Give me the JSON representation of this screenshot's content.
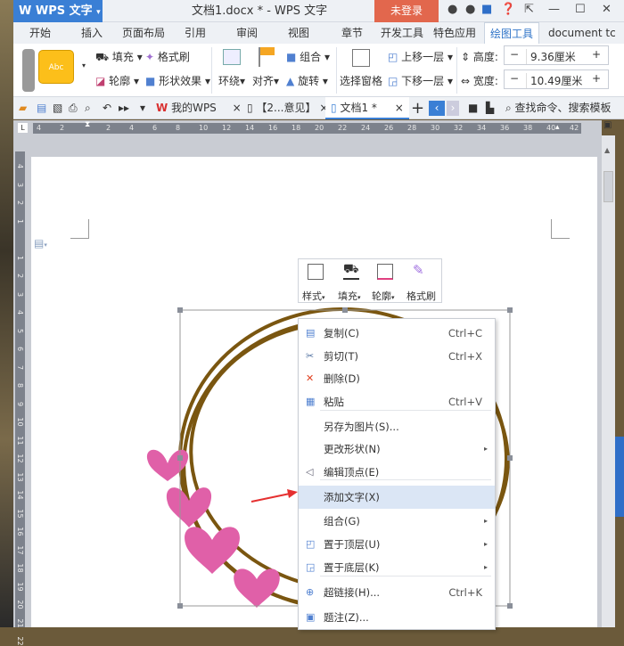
{
  "titlebar": {
    "app_button": "W WPS 文字",
    "doc_title": "文档1.docx * - WPS 文字",
    "login": "未登录"
  },
  "tabs": [
    "开始",
    "插入",
    "页面布局",
    "引用",
    "审阅",
    "视图",
    "章节",
    "开发工具",
    "特色应用",
    "绘图工具",
    "document tc"
  ],
  "active_tab": "绘图工具",
  "ribbon": {
    "style_preview": "Abc",
    "fill": "填充",
    "format_painter": "格式刷",
    "outline": "轮廓",
    "shape_effects": "形状效果",
    "wrap": "环绕",
    "align": "对齐",
    "group": "组合",
    "rotate": "旋转",
    "selection_pane": "选择窗格",
    "bring_forward": "上移一层",
    "send_backward": "下移一层",
    "height_label": "高度:",
    "height_value": "9.36厘米",
    "width_label": "宽度:",
    "width_value": "10.49厘米"
  },
  "doc_tabs": [
    {
      "label": "我的WPS"
    },
    {
      "label": "【2...意见】"
    },
    {
      "label": "文档1 *"
    }
  ],
  "search_placeholder": "查找命令、搜索模板",
  "ruler": {
    "h_ticks": [
      "4",
      "2",
      "",
      "2",
      "4",
      "6",
      "8",
      "10",
      "12",
      "14",
      "16",
      "18",
      "20",
      "22",
      "24",
      "26",
      "28",
      "30",
      "32",
      "34",
      "36",
      "38",
      "40",
      "42"
    ],
    "v_ticks": [
      "4",
      "3",
      "2",
      "1",
      "",
      "1",
      "2",
      "3",
      "4",
      "5",
      "6",
      "7",
      "8",
      "9",
      "10",
      "11",
      "12",
      "13",
      "14",
      "15",
      "16",
      "17",
      "18",
      "19",
      "20",
      "21",
      "22"
    ]
  },
  "mini_toolbar": {
    "style": "样式",
    "fill": "填充",
    "outline": "轮廓",
    "painter": "格式刷"
  },
  "context_menu": [
    {
      "label": "复制(C)",
      "shortcut": "Ctrl+C",
      "icon": "copy-icon"
    },
    {
      "label": "剪切(T)",
      "shortcut": "Ctrl+X",
      "icon": "scissors-icon"
    },
    {
      "label": "删除(D)",
      "shortcut": "",
      "icon": "delete-icon"
    },
    {
      "label": "粘贴",
      "shortcut": "Ctrl+V",
      "icon": "paste-icon"
    },
    {
      "label": "另存为图片(S)...",
      "shortcut": "",
      "icon": ""
    },
    {
      "label": "更改形状(N)",
      "shortcut": "",
      "icon": "",
      "submenu": true
    },
    {
      "label": "编辑顶点(E)",
      "shortcut": "",
      "icon": "edit-points-icon"
    },
    {
      "label": "添加文字(X)",
      "shortcut": "",
      "icon": "",
      "highlighted": true
    },
    {
      "label": "组合(G)",
      "shortcut": "",
      "icon": "",
      "submenu": true
    },
    {
      "label": "置于顶层(U)",
      "shortcut": "",
      "icon": "bring-front-icon",
      "submenu": true
    },
    {
      "label": "置于底层(K)",
      "shortcut": "",
      "icon": "send-back-icon",
      "submenu": true
    },
    {
      "label": "超链接(H)...",
      "shortcut": "Ctrl+K",
      "icon": "hyperlink-icon"
    },
    {
      "label": "题注(Z)...",
      "shortcut": "",
      "icon": "caption-icon"
    }
  ],
  "colors": {
    "accent": "#3a7fd5",
    "login": "#e2674d",
    "ring": "#7a5610",
    "heart": "#e060a8",
    "highlight": "#dbe6f5",
    "arrow": "#e53030"
  }
}
